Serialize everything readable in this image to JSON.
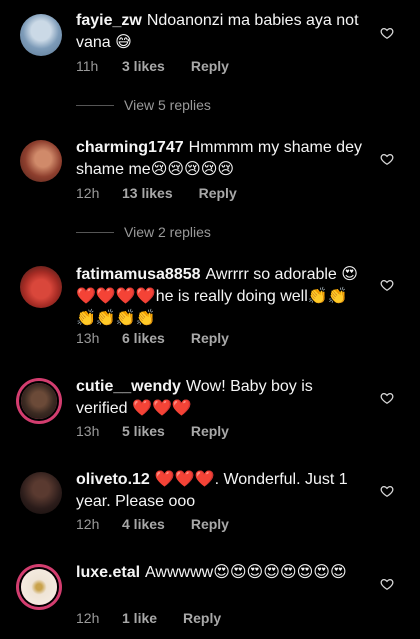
{
  "comments": [
    {
      "username": "fayie_zw",
      "text": "Ndoanonzi ma babies aya not vana 😅",
      "time": "11h",
      "likes": "3 likes",
      "reply": "Reply",
      "avatar_color": "#8aa7c4",
      "view_replies": "View 5 replies"
    },
    {
      "username": "charming1747",
      "text": "Hmmmm my shame dey shame me😢😢😢😢😢",
      "time": "12h",
      "likes": "13 likes",
      "reply": "Reply",
      "avatar_color": "#a0523d",
      "view_replies": "View 2 replies"
    },
    {
      "username": "fatimamusa8858",
      "text": "Awrrrr so adorable 😍❤️❤️❤️❤️he is really doing well👏👏👏👏👏👏",
      "time": "13h",
      "likes": "6 likes",
      "reply": "Reply",
      "avatar_color": "#c83b32"
    },
    {
      "username": "cutie__wendy",
      "text": "Wow! Baby boy is verified ❤️❤️❤️",
      "time": "13h",
      "likes": "5 likes",
      "reply": "Reply",
      "avatar_color": "#3b2a22",
      "ring_color": "#d33d6f"
    },
    {
      "username": "oliveto.12",
      "text": "❤️❤️❤️. Wonderful. Just 1 year. Please ooo",
      "time": "12h",
      "likes": "4 likes",
      "reply": "Reply",
      "avatar_color": "#2b1c1a"
    },
    {
      "username": "luxe.etal",
      "text": "Awwwww😍😍😍😍😍😍😍😍",
      "time": "12h",
      "likes": "1 like",
      "reply": "Reply",
      "avatar_color": "#efe4d6",
      "ring_color": "#d33d6f"
    }
  ],
  "icons": {
    "like": "heart-outline-icon"
  },
  "colors": {
    "background": "#000000",
    "text": "#f5f5f5",
    "secondary_text": "#9a9a9a",
    "story_ring": "#d33d6f"
  }
}
